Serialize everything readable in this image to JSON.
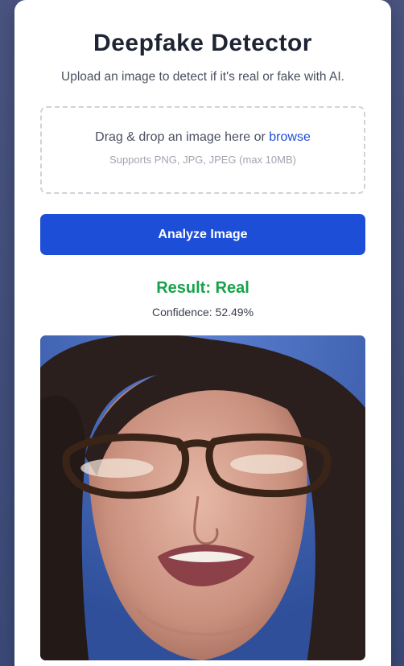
{
  "app": {
    "title": "Deepfake Detector",
    "subtitle": "Upload an image to detect if it's real or fake with AI."
  },
  "upload": {
    "prompt_prefix": "Drag & drop an image here or ",
    "browse_label": "browse",
    "hint": "Supports PNG, JPG, JPEG (max 10MB)"
  },
  "actions": {
    "analyze_label": "Analyze Image"
  },
  "result": {
    "label": "Result: Real",
    "confidence": "Confidence: 52.49%",
    "confidence_value": 52.49
  },
  "colors": {
    "accent": "#1d4ed8",
    "result_real": "#16a34a",
    "background": "#46507c"
  },
  "preview": {
    "icon": "uploaded-image-preview"
  }
}
